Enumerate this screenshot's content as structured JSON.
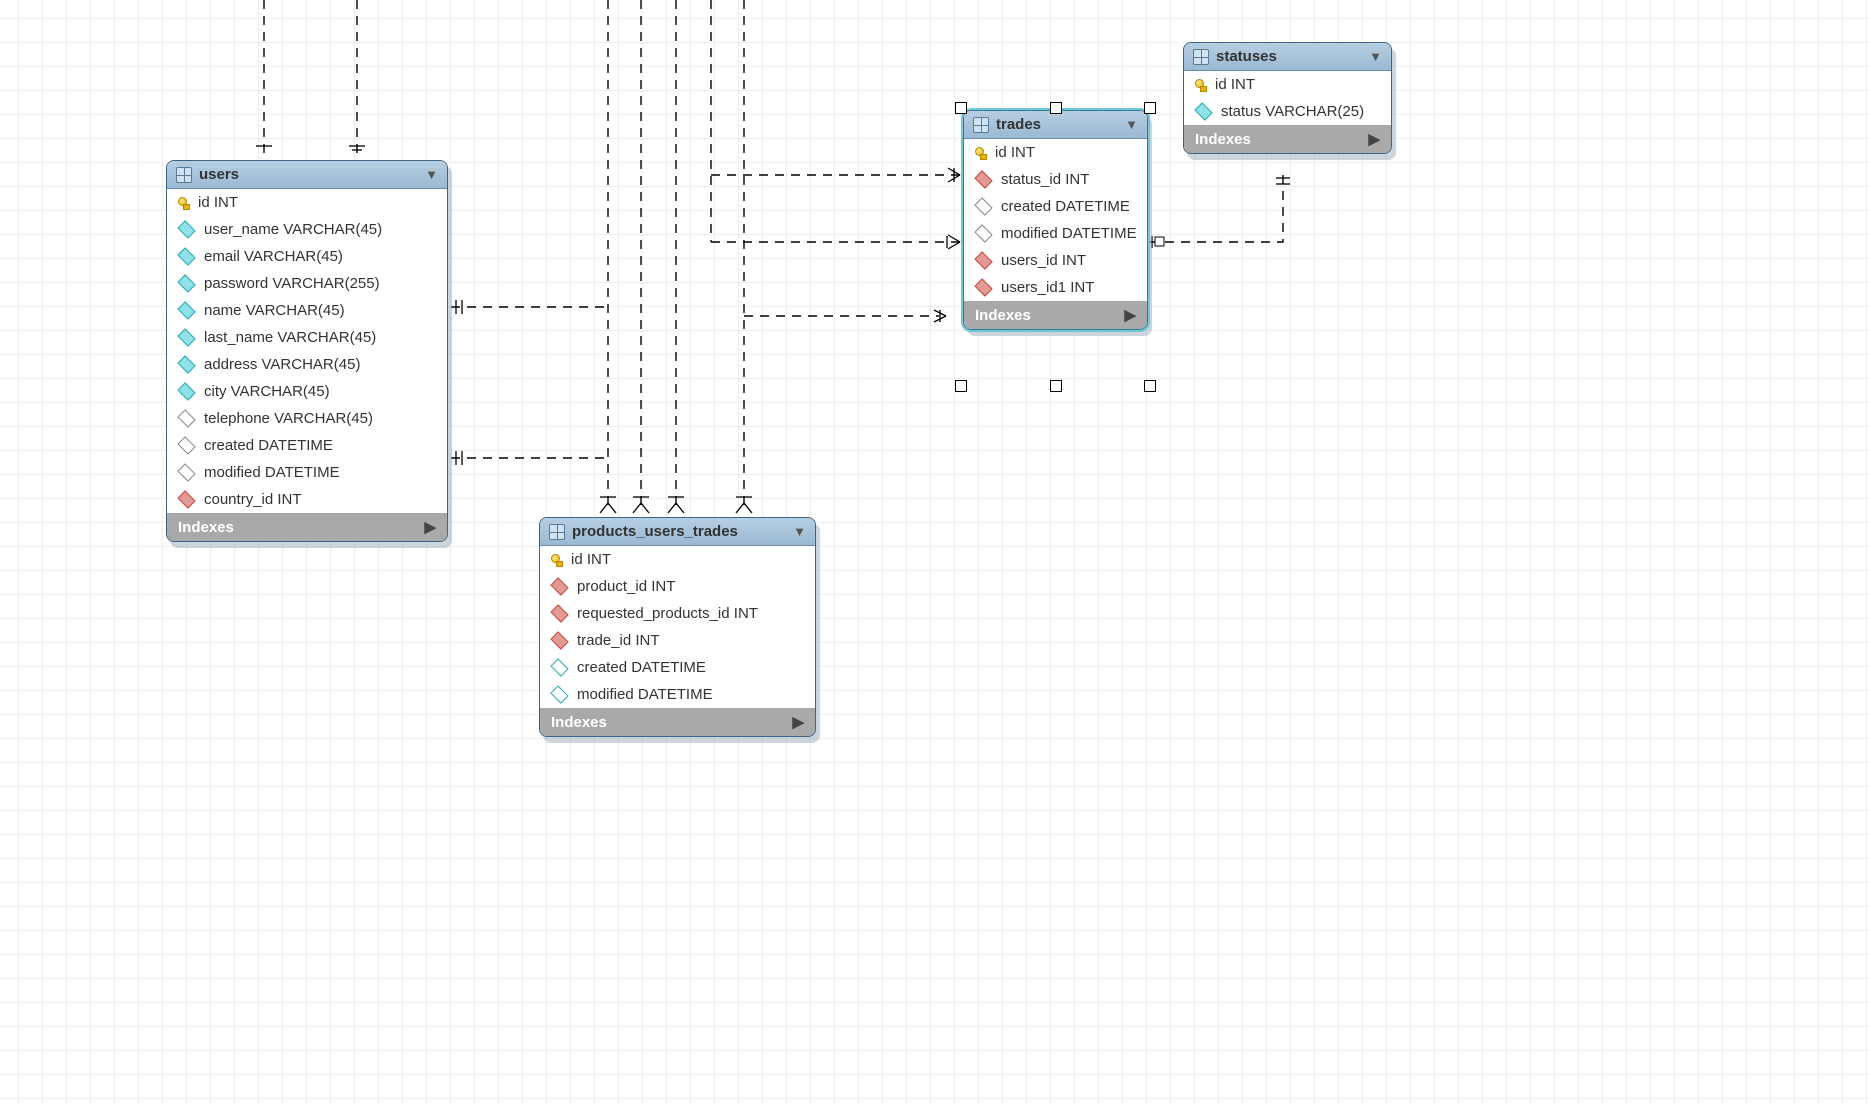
{
  "indexes_label": "Indexes",
  "entities": {
    "users": {
      "title": "users",
      "columns": [
        {
          "icon": "key",
          "label": "id INT"
        },
        {
          "icon": "cyan",
          "label": "user_name VARCHAR(45)"
        },
        {
          "icon": "cyan",
          "label": "email VARCHAR(45)"
        },
        {
          "icon": "cyan",
          "label": "password VARCHAR(255)"
        },
        {
          "icon": "cyan",
          "label": "name VARCHAR(45)"
        },
        {
          "icon": "cyan",
          "label": "last_name VARCHAR(45)"
        },
        {
          "icon": "cyan",
          "label": "address VARCHAR(45)"
        },
        {
          "icon": "cyan",
          "label": "city VARCHAR(45)"
        },
        {
          "icon": "plain",
          "label": "telephone VARCHAR(45)"
        },
        {
          "icon": "plain",
          "label": "created DATETIME"
        },
        {
          "icon": "plain",
          "label": "modified DATETIME"
        },
        {
          "icon": "red",
          "label": "country_id INT"
        }
      ]
    },
    "products_users_trades": {
      "title": "products_users_trades",
      "columns": [
        {
          "icon": "key",
          "label": "id INT"
        },
        {
          "icon": "red",
          "label": "product_id INT"
        },
        {
          "icon": "red",
          "label": "requested_products_id INT"
        },
        {
          "icon": "red",
          "label": "trade_id INT"
        },
        {
          "icon": "cyan-open",
          "label": "created DATETIME"
        },
        {
          "icon": "cyan-open",
          "label": "modified DATETIME"
        }
      ]
    },
    "trades": {
      "title": "trades",
      "columns": [
        {
          "icon": "key",
          "label": "id INT"
        },
        {
          "icon": "red",
          "label": "status_id INT"
        },
        {
          "icon": "plain",
          "label": "created DATETIME"
        },
        {
          "icon": "plain",
          "label": "modified DATETIME"
        },
        {
          "icon": "red",
          "label": "users_id INT"
        },
        {
          "icon": "red",
          "label": "users_id1 INT"
        }
      ]
    },
    "statuses": {
      "title": "statuses",
      "columns": [
        {
          "icon": "key",
          "label": "id INT"
        },
        {
          "icon": "cyan",
          "label": "status VARCHAR(25)"
        }
      ]
    }
  }
}
